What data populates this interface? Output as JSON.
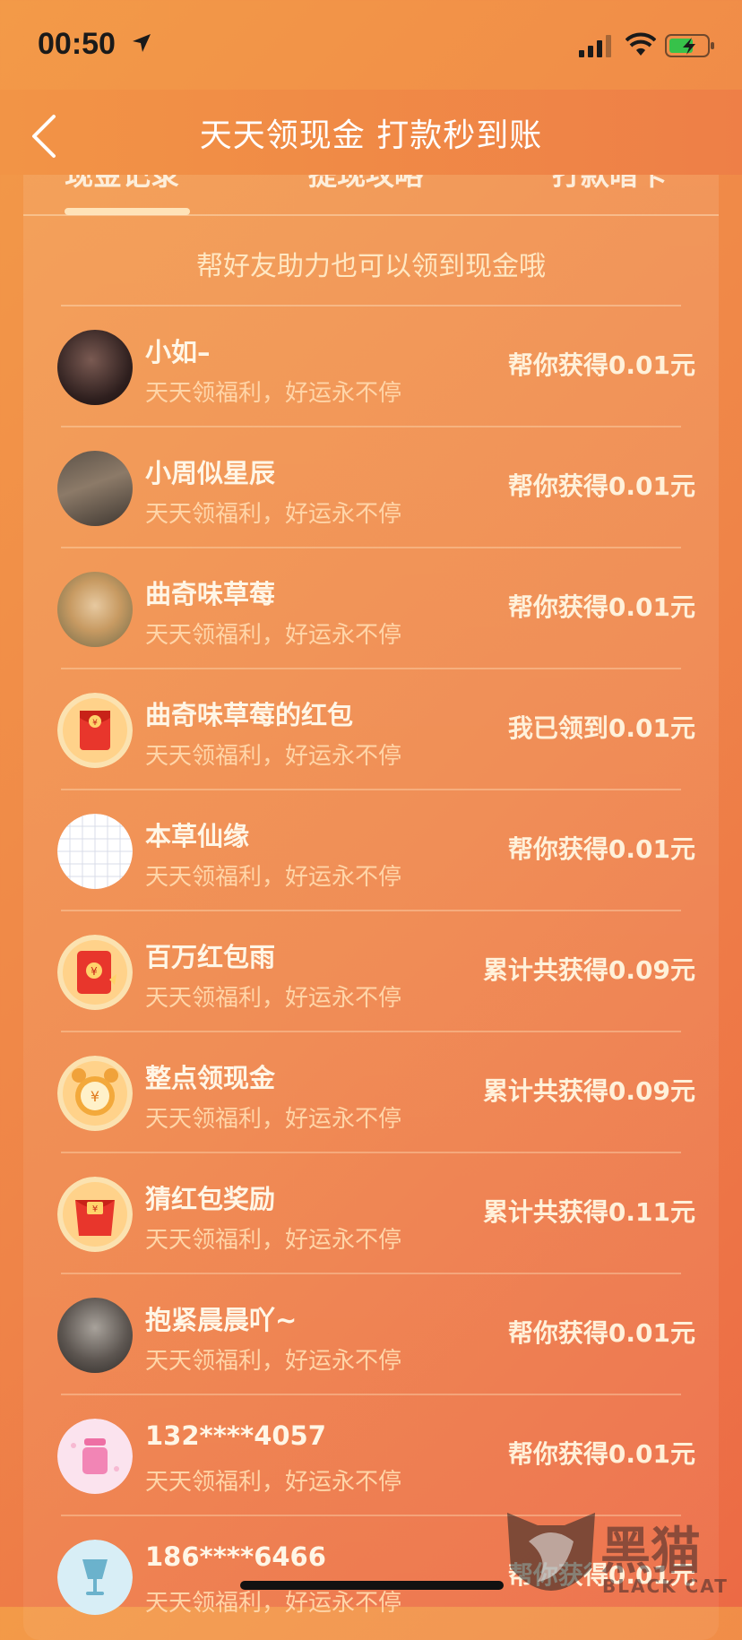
{
  "status_bar": {
    "time": "00:50"
  },
  "nav": {
    "title": "天天领现金 打款秒到账"
  },
  "tabs": [
    {
      "label": "现金记录"
    },
    {
      "label": "提现攻略"
    },
    {
      "label": "打款暗卡"
    }
  ],
  "hint": "帮好友助力也可以领到现金哦",
  "records": [
    {
      "name": "小如–",
      "subtitle": "天天领福利，好运永不停",
      "amount": "帮你获得0.01元",
      "avatar": "photo-avatar"
    },
    {
      "name": "小周似星辰",
      "subtitle": "天天领福利，好运永不停",
      "amount": "帮你获得0.01元",
      "avatar": "photo-avatar"
    },
    {
      "name": "曲奇味草莓",
      "subtitle": "天天领福利，好运永不停",
      "amount": "帮你获得0.01元",
      "avatar": "cat-photo-avatar"
    },
    {
      "name": "曲奇味草莓的红包",
      "subtitle": "天天领福利，好运永不停",
      "amount": "我已领到0.01元",
      "avatar": "red-envelope-icon"
    },
    {
      "name": "本草仙缘",
      "subtitle": "天天领福利，好运永不停",
      "amount": "帮你获得0.01元",
      "avatar": "grid-avatar"
    },
    {
      "name": "百万红包雨",
      "subtitle": "天天领福利，好运永不停",
      "amount": "累计共获得0.09元",
      "avatar": "red-envelope-icon"
    },
    {
      "name": "整点领现金",
      "subtitle": "天天领福利，好运永不停",
      "amount": "累计共获得0.09元",
      "avatar": "alarm-clock-icon"
    },
    {
      "name": "猜红包奖励",
      "subtitle": "天天领福利，好运永不停",
      "amount": "累计共获得0.11元",
      "avatar": "red-bag-icon"
    },
    {
      "name": "抱紧晨晨吖~",
      "subtitle": "天天领福利，好运永不停",
      "amount": "帮你获得0.01元",
      "avatar": "photo-avatar"
    },
    {
      "name": "132****4057",
      "subtitle": "天天领福利，好运永不停",
      "amount": "帮你获得0.01元",
      "avatar": "pink-jar-avatar"
    },
    {
      "name": "186****6466",
      "subtitle": "天天领福利，好运永不停",
      "amount": "帮你获得0.01元",
      "avatar": "blue-cup-avatar"
    }
  ],
  "watermark": {
    "text": "黑猫",
    "sub": "BLACK CAT"
  },
  "colors": {
    "background": "#f08a47",
    "text_light": "#fff6e6",
    "subtitle": "#ffd5a8"
  }
}
